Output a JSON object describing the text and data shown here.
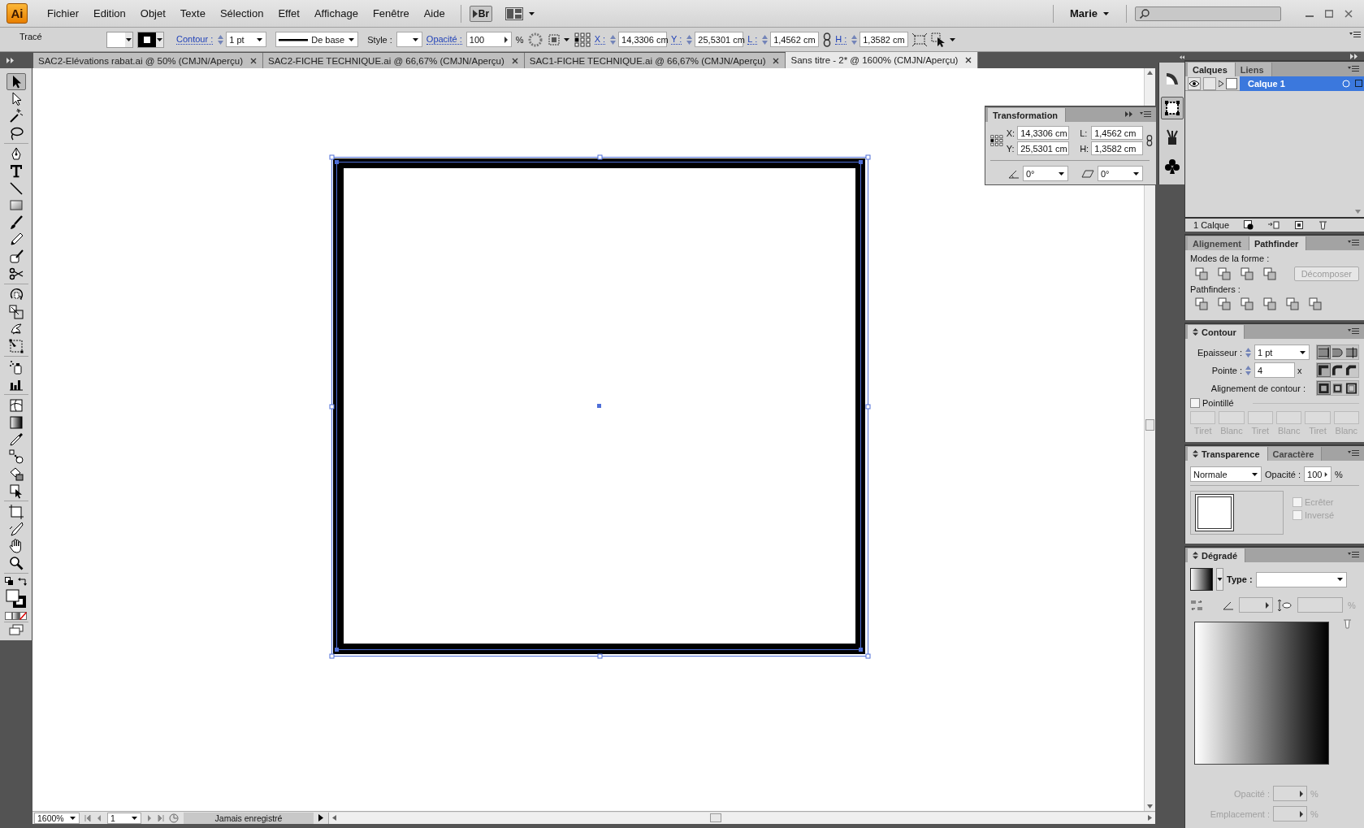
{
  "app": {
    "logo": "Ai",
    "bridge_button": "Br",
    "user": "Marie"
  },
  "menu": [
    "Fichier",
    "Edition",
    "Objet",
    "Texte",
    "Sélection",
    "Effet",
    "Affichage",
    "Fenêtre",
    "Aide"
  ],
  "control_bar": {
    "selection_type": "Tracé",
    "stroke_label": "Contour :",
    "stroke_weight": "1 pt",
    "brush": "De base",
    "style_label": "Style :",
    "opacity_label": "Opacité :",
    "opacity": "100",
    "opacity_unit": "%",
    "x_label": "X :",
    "x": "14,3306 cm",
    "y_label": "Y :",
    "y": "25,5301 cm",
    "w_label": "L :",
    "w": "1,4562 cm",
    "h_label": "H :",
    "h": "1,3582 cm"
  },
  "tabs": [
    {
      "label": "SAC2-Elévations rabat.ai @ 50% (CMJN/Aperçu)",
      "selected": false
    },
    {
      "label": "SAC2-FICHE TECHNIQUE.ai @ 66,67% (CMJN/Aperçu)",
      "selected": false
    },
    {
      "label": "SAC1-FICHE TECHNIQUE.ai @ 66,67% (CMJN/Aperçu)",
      "selected": false
    },
    {
      "label": "Sans titre - 2* @ 1600% (CMJN/Aperçu)",
      "selected": true
    }
  ],
  "tool_groups": [
    {
      "tools": [
        {
          "kind": "select",
          "selected": true
        },
        {
          "kind": "direct-select",
          "selected": false
        },
        {
          "kind": "magic-wand",
          "selected": false
        },
        {
          "kind": "lasso",
          "selected": false
        }
      ]
    },
    {
      "tools": [
        {
          "kind": "pen",
          "selected": false
        },
        {
          "kind": "type",
          "selected": false
        },
        {
          "kind": "line",
          "selected": false
        },
        {
          "kind": "rectangle",
          "selected": false
        },
        {
          "kind": "brush",
          "selected": false
        },
        {
          "kind": "pencil",
          "selected": false
        },
        {
          "kind": "blob-brush",
          "selected": false
        },
        {
          "kind": "scissors",
          "selected": false
        }
      ]
    },
    {
      "tools": [
        {
          "kind": "rotate",
          "selected": false
        },
        {
          "kind": "scale",
          "selected": false
        },
        {
          "kind": "warp",
          "selected": false
        },
        {
          "kind": "free-transform",
          "selected": false
        }
      ]
    },
    {
      "tools": [
        {
          "kind": "symbol-sprayer",
          "selected": false
        },
        {
          "kind": "graph",
          "selected": false
        }
      ]
    },
    {
      "tools": [
        {
          "kind": "mesh",
          "selected": false
        },
        {
          "kind": "gradient",
          "selected": false
        },
        {
          "kind": "eyedropper",
          "selected": false
        },
        {
          "kind": "blend",
          "selected": false
        },
        {
          "kind": "live-paint",
          "selected": false
        },
        {
          "kind": "live-paint-select",
          "selected": false
        }
      ]
    },
    {
      "tools": [
        {
          "kind": "artboard",
          "selected": false
        },
        {
          "kind": "slice",
          "selected": false
        },
        {
          "kind": "hand",
          "selected": false
        },
        {
          "kind": "zoom",
          "selected": false
        }
      ]
    }
  ],
  "transform_panel": {
    "title": "Transformation",
    "x_label": "X:",
    "x": "14,3306 cm",
    "y_label": "Y:",
    "y": "25,5301 cm",
    "w_label": "L:",
    "w": "1,4562 cm",
    "h_label": "H:",
    "h": "1,3582 cm",
    "rotate": "0°",
    "shear": "0°"
  },
  "dock": [
    {
      "kind": "color-guide",
      "selected": false
    },
    {
      "kind": "transform",
      "selected": true
    },
    {
      "kind": "brushes",
      "selected": false
    },
    {
      "kind": "symbols",
      "selected": false
    }
  ],
  "layers_panel": {
    "tabs": [
      {
        "label": "Calques",
        "selected": true
      },
      {
        "label": "Liens",
        "selected": false
      }
    ],
    "layers": [
      {
        "name": "Calque 1",
        "visible": true,
        "selected": true
      }
    ],
    "count": "1 Calque"
  },
  "pathfinder_panel": {
    "tabs": [
      {
        "label": "Alignement",
        "selected": false
      },
      {
        "label": "Pathfinder",
        "selected": true
      }
    ],
    "shape_modes_label": "Modes de la forme :",
    "expand_button": {
      "label": "Décomposer",
      "disabled": true
    },
    "pathfinders_label": "Pathfinders :"
  },
  "stroke_panel": {
    "title": "Contour",
    "weight_label": "Epaisseur :",
    "weight": "1 pt",
    "miter_label": "Pointe :",
    "miter": "4",
    "miter_unit": "x",
    "align_label": "Alignement de contour :",
    "caps": [
      {
        "kind": "butt",
        "selected": true
      },
      {
        "kind": "round",
        "selected": false
      },
      {
        "kind": "projecting",
        "selected": false
      }
    ],
    "joins": [
      {
        "kind": "miter",
        "selected": true
      },
      {
        "kind": "round",
        "selected": false
      },
      {
        "kind": "bevel",
        "selected": false
      }
    ],
    "aligns": [
      {
        "kind": "center",
        "selected": true
      },
      {
        "kind": "inside",
        "selected": false
      },
      {
        "kind": "outside",
        "selected": false
      }
    ],
    "dashed": {
      "label": "Pointillé",
      "checked": false
    },
    "dash_fields": [
      {
        "label": "Tiret",
        "disabled": true
      },
      {
        "label": "Blanc",
        "disabled": true
      },
      {
        "label": "Tiret",
        "disabled": true
      },
      {
        "label": "Blanc",
        "disabled": true
      },
      {
        "label": "Tiret",
        "disabled": true
      },
      {
        "label": "Blanc",
        "disabled": true
      }
    ]
  },
  "transparency_panel": {
    "tabs": [
      {
        "label": "Transparence",
        "selected": true
      },
      {
        "label": "Caractère",
        "selected": false
      }
    ],
    "blend_mode": "Normale",
    "opacity_label": "Opacité :",
    "opacity": "100",
    "opacity_unit": "%",
    "options": [
      {
        "label": "Ecrêter",
        "checked": false,
        "disabled": true
      },
      {
        "label": "Inversé",
        "checked": false,
        "disabled": true
      }
    ]
  },
  "gradient_panel": {
    "title": "Dégradé",
    "type_label": "Type :",
    "aspect_unit": "%",
    "opacity_label": "Opacité :",
    "opacity_unit": "%",
    "location_label": "Emplacement :",
    "location_unit": "%",
    "disabled": true
  },
  "status_bar": {
    "zoom": "1600%",
    "page": "1",
    "status": "Jamais enregistré"
  }
}
